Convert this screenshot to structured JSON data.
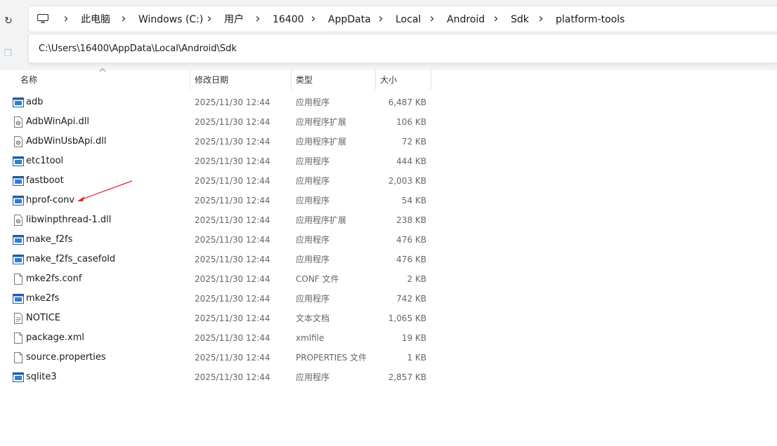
{
  "breadcrumb": {
    "items": [
      "此电脑",
      "Windows (C:)",
      "用户",
      "16400",
      "AppData",
      "Local",
      "Android",
      "Sdk",
      "platform-tools"
    ]
  },
  "address": {
    "value": "C:\\Users\\16400\\AppData\\Local\\Android\\Sdk"
  },
  "columns": {
    "name": "名称",
    "date": "修改日期",
    "type": "类型",
    "size": "大小"
  },
  "files": [
    {
      "name": "adb",
      "date": "2025/11/30 12:44",
      "type": "应用程序",
      "size": "6,487 KB",
      "icon": "exe-icon"
    },
    {
      "name": "AdbWinApi.dll",
      "date": "2025/11/30 12:44",
      "type": "应用程序扩展",
      "size": "106 KB",
      "icon": "dll-icon"
    },
    {
      "name": "AdbWinUsbApi.dll",
      "date": "2025/11/30 12:44",
      "type": "应用程序扩展",
      "size": "72 KB",
      "icon": "dll-icon"
    },
    {
      "name": "etc1tool",
      "date": "2025/11/30 12:44",
      "type": "应用程序",
      "size": "444 KB",
      "icon": "exe-icon"
    },
    {
      "name": "fastboot",
      "date": "2025/11/30 12:44",
      "type": "应用程序",
      "size": "2,003 KB",
      "icon": "exe-icon"
    },
    {
      "name": "hprof-conv",
      "date": "2025/11/30 12:44",
      "type": "应用程序",
      "size": "54 KB",
      "icon": "exe-icon"
    },
    {
      "name": "libwinpthread-1.dll",
      "date": "2025/11/30 12:44",
      "type": "应用程序扩展",
      "size": "238 KB",
      "icon": "dll-icon"
    },
    {
      "name": "make_f2fs",
      "date": "2025/11/30 12:44",
      "type": "应用程序",
      "size": "476 KB",
      "icon": "exe-icon"
    },
    {
      "name": "make_f2fs_casefold",
      "date": "2025/11/30 12:44",
      "type": "应用程序",
      "size": "476 KB",
      "icon": "exe-icon"
    },
    {
      "name": "mke2fs.conf",
      "date": "2025/11/30 12:44",
      "type": "CONF 文件",
      "size": "2 KB",
      "icon": "file-icon"
    },
    {
      "name": "mke2fs",
      "date": "2025/11/30 12:44",
      "type": "应用程序",
      "size": "742 KB",
      "icon": "exe-icon"
    },
    {
      "name": "NOTICE",
      "date": "2025/11/30 12:44",
      "type": "文本文档",
      "size": "1,065 KB",
      "icon": "text-file-icon"
    },
    {
      "name": "package.xml",
      "date": "2025/11/30 12:44",
      "type": "xmlfile",
      "size": "19 KB",
      "icon": "file-icon"
    },
    {
      "name": "source.properties",
      "date": "2025/11/30 12:44",
      "type": "PROPERTIES 文件",
      "size": "1 KB",
      "icon": "file-icon"
    },
    {
      "name": "sqlite3",
      "date": "2025/11/30 12:44",
      "type": "应用程序",
      "size": "2,857 KB",
      "icon": "exe-icon"
    }
  ],
  "annotation": {
    "color": "#e8202a",
    "points_to": "hprof-conv"
  },
  "colors": {
    "accent": "#1a73c9",
    "toolbar_bg": "#f3f3f3"
  }
}
